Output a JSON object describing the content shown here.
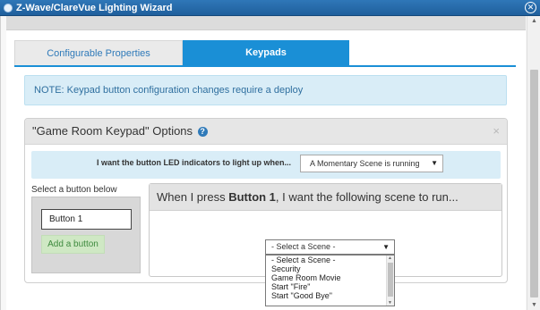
{
  "window": {
    "title": "Z-Wave/ClareVue Lighting Wizard",
    "close_symbol": "✕"
  },
  "tabs": [
    {
      "label": "Configurable Properties",
      "active": false
    },
    {
      "label": "Keypads",
      "active": true
    }
  ],
  "note": "NOTE: Keypad button configuration changes require a deploy",
  "panel": {
    "title": "\"Game Room Keypad\" Options",
    "help_symbol": "?",
    "close_symbol": "×",
    "led_label": "I want the button LED indicators to light up when...",
    "led_value": "A Momentary Scene is running",
    "select_button_label": "Select a button below",
    "button_name": "Button 1",
    "add_button_label": "Add a button",
    "scene_prompt_prefix": "When I press ",
    "scene_prompt_button": "Button 1",
    "scene_prompt_suffix": ", I want the following scene to run..."
  },
  "scene_select": {
    "value": "- Select a Scene -",
    "options": [
      "- Select a Scene -",
      "Security",
      "Game Room Movie",
      "Start \"Fire\"",
      "Start \"Good Bye\""
    ]
  },
  "icons": {
    "title": "app-icon",
    "help": "help-icon",
    "close": "close-icon",
    "dropdown": "chevron-down-icon"
  },
  "colors": {
    "titlebar": "#2f77b8",
    "tab_active": "#1a8fd6",
    "tab_active_text": "#ffffff",
    "note_bg": "#d9edf7",
    "add_button_bg": "#cfe8c4"
  }
}
